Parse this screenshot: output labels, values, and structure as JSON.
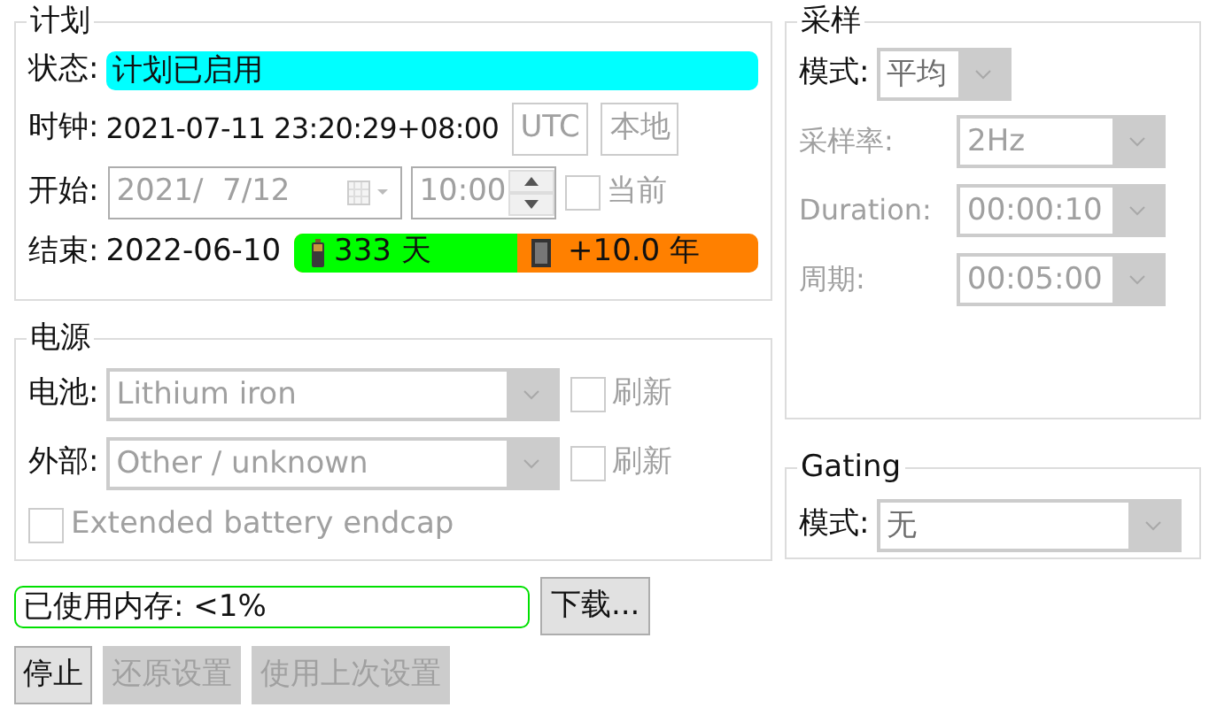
{
  "plan": {
    "title": "计划",
    "status_label": "状态:",
    "status_value": "计划已启用",
    "clock_label": "时钟:",
    "clock_value": "2021-07-11 23:20:29+08:00",
    "clock_buttons": [
      {
        "label": "UTC",
        "disabled": true
      },
      {
        "label": "本地",
        "disabled": true
      }
    ],
    "start_label": "开始:",
    "start_date": "2021/  7/12",
    "start_time": "10:00",
    "now_checkbox": {
      "label": "当前",
      "checked": false,
      "disabled": true
    },
    "end_label": "结束:",
    "end_value": "2022-06-10",
    "battery_text": "333 天",
    "memory_text": "+10.0 年",
    "level": 0.48
  },
  "power": {
    "title": "电源",
    "rows": [
      {
        "label": "电池:",
        "value": "Lithium iron",
        "refresh": {
          "label": "刷新",
          "checked": false,
          "disabled": true
        }
      },
      {
        "label": "外部:",
        "value": "Other / unknown",
        "refresh": {
          "label": "刷新",
          "checked": false,
          "disabled": true
        }
      }
    ],
    "extended": {
      "label": "Extended battery endcap",
      "checked": false,
      "disabled": true
    }
  },
  "memory": {
    "text": "已使用内存: <1%",
    "button": "下载..."
  },
  "buttons": [
    {
      "label": "停止",
      "disabled": false
    },
    {
      "label": "还原设置",
      "disabled": true
    },
    {
      "label": "使用上次设置",
      "disabled": true
    }
  ],
  "sampling": {
    "title": "采样",
    "mode_label": "模式:",
    "mode_value": "平均",
    "fields": [
      {
        "label": "采样率:",
        "value": "2Hz",
        "disabled": true
      },
      {
        "label": "Duration:",
        "value": "00:00:10",
        "disabled": true
      },
      {
        "label": "周期:",
        "value": "00:05:00",
        "disabled": true
      }
    ]
  },
  "gating": {
    "title": "Gating",
    "mode_label": "模式:",
    "mode_value": "无"
  }
}
